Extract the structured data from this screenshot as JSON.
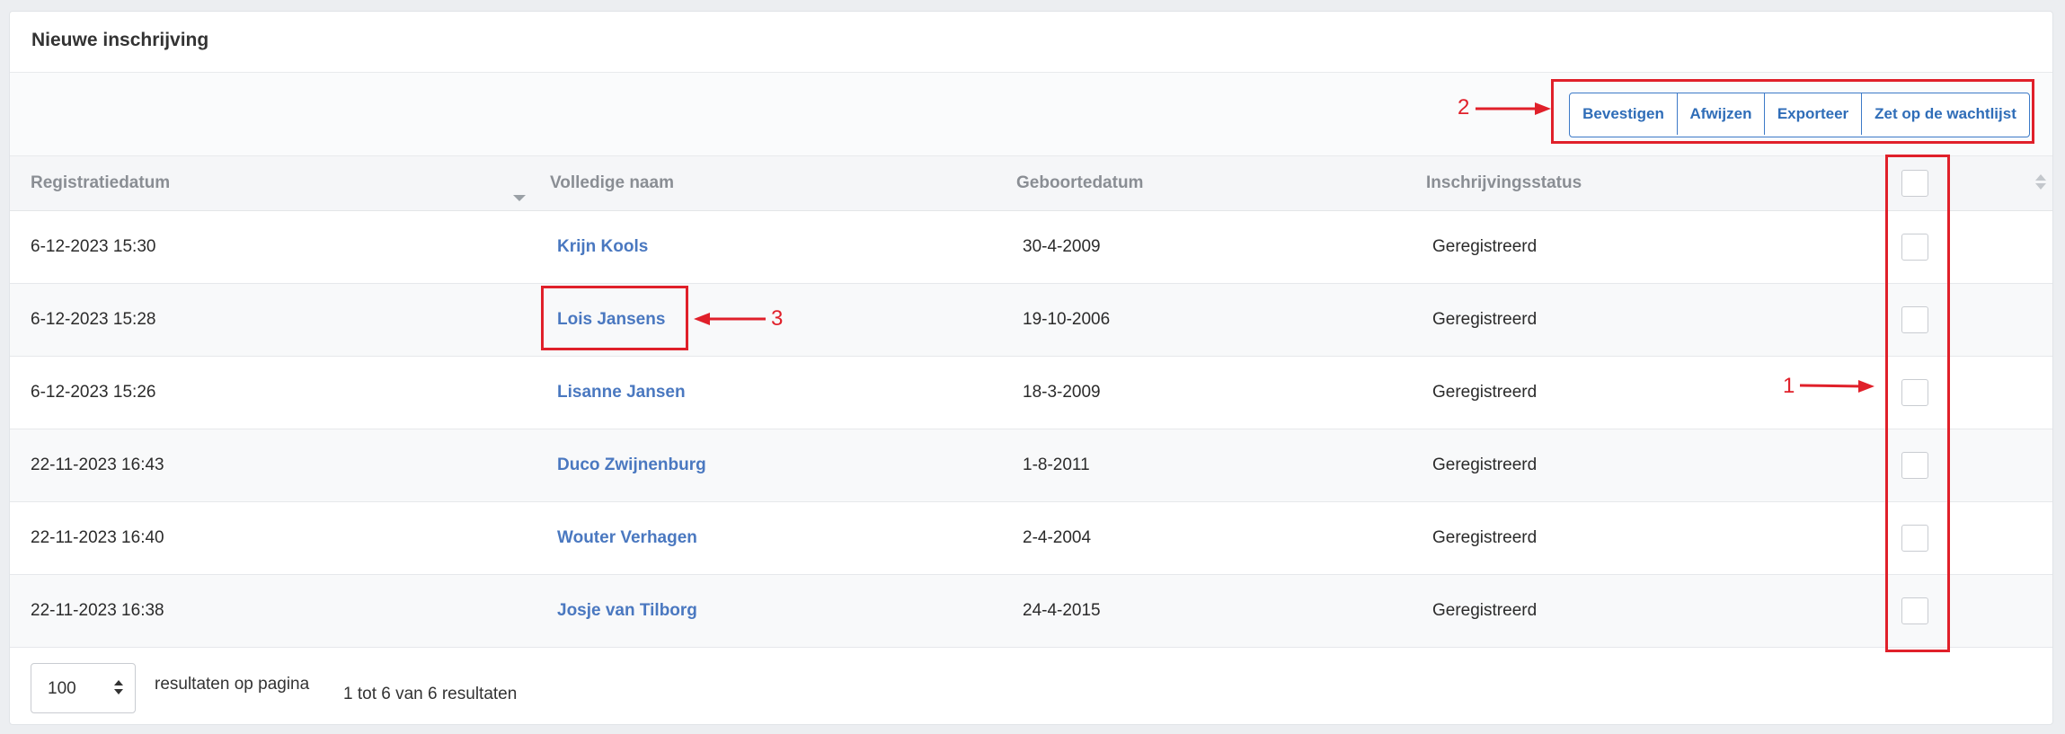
{
  "card": {
    "title": "Nieuwe inschrijving"
  },
  "toolbar": {
    "buttons": [
      "Bevestigen",
      "Afwijzen",
      "Exporteer",
      "Zet op de wachtlijst"
    ]
  },
  "table": {
    "headers": [
      "Registratiedatum",
      "Volledige naam",
      "Geboortedatum",
      "Inschrijvingsstatus"
    ],
    "rows": [
      [
        "6-12-2023 15:30",
        "Krijn Kools",
        "30-4-2009",
        "Geregistreerd"
      ],
      [
        "6-12-2023 15:28",
        "Lois Jansens",
        "19-10-2006",
        "Geregistreerd"
      ],
      [
        "6-12-2023 15:26",
        "Lisanne Jansen",
        "18-3-2009",
        "Geregistreerd"
      ],
      [
        "22-11-2023 16:43",
        "Duco Zwijnenburg",
        "1-8-2011",
        "Geregistreerd"
      ],
      [
        "22-11-2023 16:40",
        "Wouter Verhagen",
        "2-4-2004",
        "Geregistreerd"
      ],
      [
        "22-11-2023 16:38",
        "Josje van Tilborg",
        "24-4-2015",
        "Geregistreerd"
      ]
    ]
  },
  "footer": {
    "page_size": "100",
    "page_size_label": "resultaten op pagina",
    "info": "1 tot 6 van 6 resultaten"
  },
  "annotations": {
    "labels": [
      "1",
      "2",
      "3"
    ],
    "color": "#e0202a"
  },
  "colors": {
    "accent": "#2f6db8",
    "link": "#4a78c0"
  }
}
